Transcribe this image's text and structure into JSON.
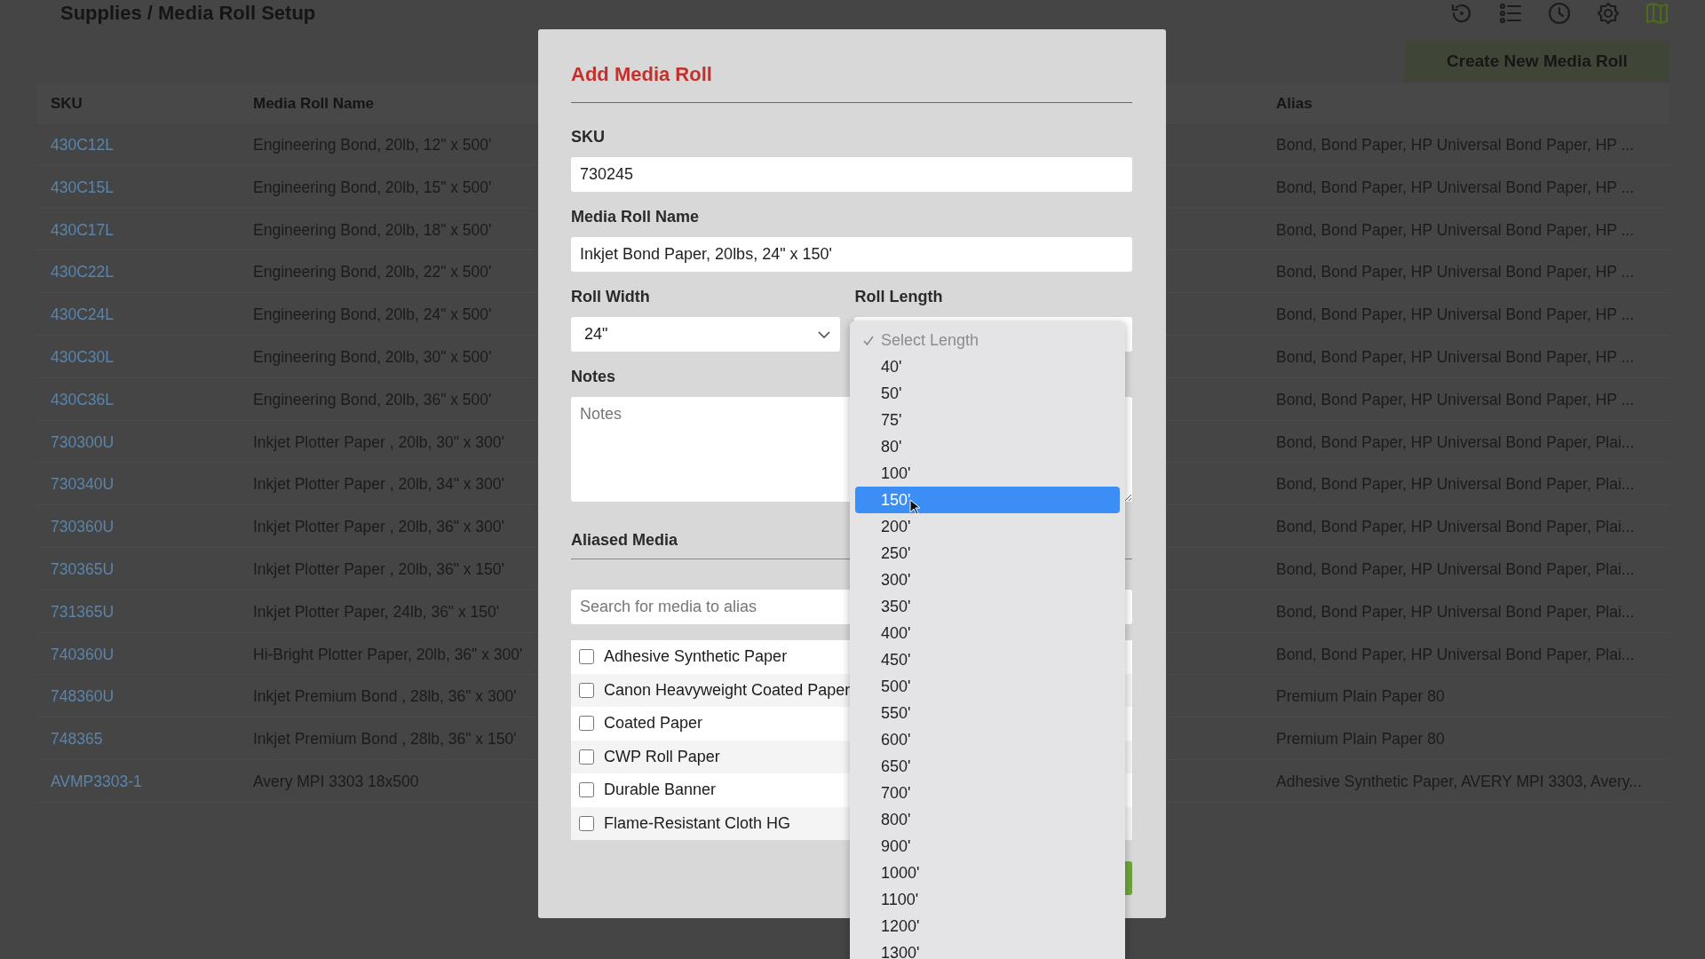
{
  "page": {
    "title": "Supplies / Media Roll Setup"
  },
  "create_button": {
    "label": "Create New Media Roll"
  },
  "table": {
    "columns": [
      "SKU",
      "Media Roll Name",
      "Alias"
    ],
    "rows": [
      {
        "sku": "430C12L",
        "name": "Engineering Bond, 20lb, 12\" x 500'",
        "alias": "Bond, Bond Paper, HP Universal Bond Paper, HP ..."
      },
      {
        "sku": "430C15L",
        "name": "Engineering Bond, 20lb, 15\" x 500'",
        "alias": "Bond, Bond Paper, HP Universal Bond Paper, HP ..."
      },
      {
        "sku": "430C17L",
        "name": "Engineering Bond, 20lb, 18\" x 500'",
        "alias": "Bond, Bond Paper, HP Universal Bond Paper, HP ..."
      },
      {
        "sku": "430C22L",
        "name": "Engineering Bond, 20lb, 22\" x 500'",
        "alias": "Bond, Bond Paper, HP Universal Bond Paper, HP ..."
      },
      {
        "sku": "430C24L",
        "name": "Engineering Bond, 20lb, 24\" x 500'",
        "alias": "Bond, Bond Paper, HP Universal Bond Paper, HP ..."
      },
      {
        "sku": "430C30L",
        "name": "Engineering Bond, 20lb, 30\" x 500'",
        "alias": "Bond, Bond Paper, HP Universal Bond Paper, HP ..."
      },
      {
        "sku": "430C36L",
        "name": "Engineering Bond, 20lb, 36\" x 500'",
        "alias": "Bond, Bond Paper, HP Universal Bond Paper, HP ..."
      },
      {
        "sku": "730300U",
        "name": "Inkjet Plotter Paper , 20lb, 30\" x 300'",
        "alias": "Bond, Bond Paper, HP Universal Bond Paper, Plai..."
      },
      {
        "sku": "730340U",
        "name": "Inkjet Plotter Paper , 20lb, 34\" x 300'",
        "alias": "Bond, Bond Paper, HP Universal Bond Paper, Plai..."
      },
      {
        "sku": "730360U",
        "name": "Inkjet Plotter Paper , 20lb, 36\" x 300'",
        "alias": "Bond, Bond Paper, HP Universal Bond Paper, Plai..."
      },
      {
        "sku": "730365U",
        "name": "Inkjet Plotter Paper , 20lb, 36\" x 150'",
        "alias": "Bond, Bond Paper, HP Universal Bond Paper, Plai..."
      },
      {
        "sku": "731365U",
        "name": "Inkjet Plotter Paper, 24lb, 36\" x 150'",
        "alias": "Bond, Bond Paper, HP Universal Bond Paper, Plai..."
      },
      {
        "sku": "740360U",
        "name": "Hi-Bright Plotter Paper, 20lb, 36\" x 300'",
        "alias": "Bond, Bond Paper, HP Universal Bond Paper, Plai..."
      },
      {
        "sku": "748360U",
        "name": "Inkjet Premium Bond , 28lb, 36\" x 300'",
        "alias": "Premium Plain Paper 80"
      },
      {
        "sku": "748365",
        "name": "Inkjet Premium Bond , 28lb, 36\" x 150'",
        "alias": "Premium Plain Paper 80"
      },
      {
        "sku": "AVMP3303-1",
        "name": "Avery MPI 3303 18x500",
        "alias": "Adhesive Synthetic Paper, AVERY MPI 3303, Avery..."
      }
    ]
  },
  "dialog": {
    "title": "Add Media Roll",
    "sku": {
      "label": "SKU",
      "value": "730245"
    },
    "media_roll_name": {
      "label": "Media Roll Name",
      "value": "Inkjet Bond Paper, 20lbs, 24\" x 150'"
    },
    "roll_width": {
      "label": "Roll Width",
      "value": "24\""
    },
    "roll_length": {
      "label": "Roll Length"
    },
    "notes": {
      "label": "Notes",
      "placeholder": "Notes"
    },
    "aliased_media": {
      "label": "Aliased Media",
      "search_placeholder": "Search for media to alias",
      "items": [
        {
          "label": "Adhesive Synthetic Paper",
          "checked": false
        },
        {
          "label": "Canon Heavyweight Coated Paper",
          "checked": false
        },
        {
          "label": "Coated Paper",
          "checked": false
        },
        {
          "label": "CWP Roll Paper",
          "checked": false
        },
        {
          "label": "Durable Banner",
          "checked": false
        },
        {
          "label": "Flame-Resistant Cloth HG",
          "checked": false
        }
      ]
    }
  },
  "length_dropdown": {
    "options": [
      {
        "label": "Select Length",
        "checked": true,
        "disabled": true,
        "selected": false
      },
      {
        "label": "40'",
        "checked": false,
        "disabled": false,
        "selected": false
      },
      {
        "label": "50'",
        "checked": false,
        "disabled": false,
        "selected": false
      },
      {
        "label": "75'",
        "checked": false,
        "disabled": false,
        "selected": false
      },
      {
        "label": "80'",
        "checked": false,
        "disabled": false,
        "selected": false
      },
      {
        "label": "100'",
        "checked": false,
        "disabled": false,
        "selected": false
      },
      {
        "label": "150'",
        "checked": false,
        "disabled": false,
        "selected": true
      },
      {
        "label": "200'",
        "checked": false,
        "disabled": false,
        "selected": false
      },
      {
        "label": "250'",
        "checked": false,
        "disabled": false,
        "selected": false
      },
      {
        "label": "300'",
        "checked": false,
        "disabled": false,
        "selected": false
      },
      {
        "label": "350'",
        "checked": false,
        "disabled": false,
        "selected": false
      },
      {
        "label": "400'",
        "checked": false,
        "disabled": false,
        "selected": false
      },
      {
        "label": "450'",
        "checked": false,
        "disabled": false,
        "selected": false
      },
      {
        "label": "500'",
        "checked": false,
        "disabled": false,
        "selected": false
      },
      {
        "label": "550'",
        "checked": false,
        "disabled": false,
        "selected": false
      },
      {
        "label": "600'",
        "checked": false,
        "disabled": false,
        "selected": false
      },
      {
        "label": "650'",
        "checked": false,
        "disabled": false,
        "selected": false
      },
      {
        "label": "700'",
        "checked": false,
        "disabled": false,
        "selected": false
      },
      {
        "label": "800'",
        "checked": false,
        "disabled": false,
        "selected": false
      },
      {
        "label": "900'",
        "checked": false,
        "disabled": false,
        "selected": false
      },
      {
        "label": "1000'",
        "checked": false,
        "disabled": false,
        "selected": false
      },
      {
        "label": "1100'",
        "checked": false,
        "disabled": false,
        "selected": false
      },
      {
        "label": "1200'",
        "checked": false,
        "disabled": false,
        "selected": false
      },
      {
        "label": "1300'",
        "checked": false,
        "disabled": false,
        "selected": false
      }
    ]
  }
}
